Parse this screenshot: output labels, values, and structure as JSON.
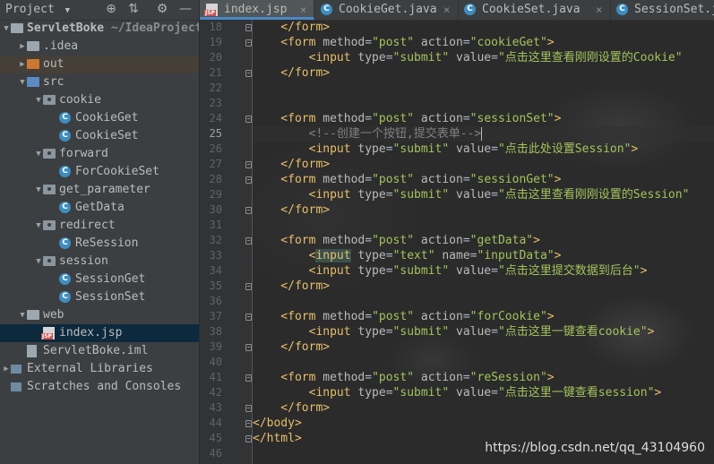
{
  "project_panel": {
    "title": "Project",
    "toolbar_icons": [
      "target-icon",
      "collapse-icon",
      "gear-icon",
      "minimize-icon"
    ],
    "tree": [
      {
        "label": "ServletBoke",
        "suffix": "~/IdeaProjects",
        "indent": 0,
        "arrow": "down",
        "icon": "module",
        "bold": true
      },
      {
        "label": ".idea",
        "indent": 1,
        "arrow": "right",
        "icon": "folder-grey"
      },
      {
        "label": "out",
        "indent": 1,
        "arrow": "right",
        "icon": "folder-orange",
        "highlight": true
      },
      {
        "label": "src",
        "indent": 1,
        "arrow": "down",
        "icon": "folder-blue"
      },
      {
        "label": "cookie",
        "indent": 2,
        "arrow": "down",
        "icon": "package"
      },
      {
        "label": "CookieGet",
        "indent": 3,
        "arrow": "",
        "icon": "class"
      },
      {
        "label": "CookieSet",
        "indent": 3,
        "arrow": "",
        "icon": "class"
      },
      {
        "label": "forward",
        "indent": 2,
        "arrow": "down",
        "icon": "package"
      },
      {
        "label": "ForCookieSet",
        "indent": 3,
        "arrow": "",
        "icon": "class"
      },
      {
        "label": "get_parameter",
        "indent": 2,
        "arrow": "down",
        "icon": "package"
      },
      {
        "label": "GetData",
        "indent": 3,
        "arrow": "",
        "icon": "class"
      },
      {
        "label": "redirect",
        "indent": 2,
        "arrow": "down",
        "icon": "package"
      },
      {
        "label": "ReSession",
        "indent": 3,
        "arrow": "",
        "icon": "class"
      },
      {
        "label": "session",
        "indent": 2,
        "arrow": "down",
        "icon": "package"
      },
      {
        "label": "SessionGet",
        "indent": 3,
        "arrow": "",
        "icon": "class"
      },
      {
        "label": "SessionSet",
        "indent": 3,
        "arrow": "",
        "icon": "class"
      },
      {
        "label": "web",
        "indent": 1,
        "arrow": "down",
        "icon": "folder-web"
      },
      {
        "label": "index.jsp",
        "indent": 2,
        "arrow": "",
        "icon": "jsp",
        "selected": true
      },
      {
        "label": "ServletBoke.iml",
        "indent": 1,
        "arrow": "",
        "icon": "iml"
      },
      {
        "label": "External Libraries",
        "indent": 0,
        "arrow": "right",
        "icon": "library"
      },
      {
        "label": "Scratches and Consoles",
        "indent": 0,
        "arrow": "",
        "icon": "scratch"
      }
    ]
  },
  "tabs": [
    {
      "label": "index.jsp",
      "icon": "jsp",
      "active": true
    },
    {
      "label": "CookieGet.java",
      "icon": "class",
      "active": false
    },
    {
      "label": "CookieSet.java",
      "icon": "class",
      "active": false
    },
    {
      "label": "SessionSet.ja",
      "icon": "class",
      "active": false
    }
  ],
  "editor": {
    "current_line": 25,
    "lines": [
      {
        "n": "18",
        "tokens": [
          [
            "tag",
            "    </form>"
          ]
        ]
      },
      {
        "n": "19",
        "tokens": [
          [
            "tag",
            "    <form "
          ],
          [
            "attr",
            "method"
          ],
          [
            "eq",
            "="
          ],
          [
            "val",
            "\"post\""
          ],
          [
            "tag",
            " "
          ],
          [
            "attr",
            "action"
          ],
          [
            "eq",
            "="
          ],
          [
            "val",
            "\"cookieGet\""
          ],
          [
            "tag",
            ">"
          ]
        ]
      },
      {
        "n": "20",
        "tokens": [
          [
            "tag",
            "        <input "
          ],
          [
            "attr",
            "type"
          ],
          [
            "eq",
            "="
          ],
          [
            "val",
            "\"submit\""
          ],
          [
            "tag",
            " "
          ],
          [
            "attr",
            "value"
          ],
          [
            "eq",
            "="
          ],
          [
            "val",
            "\"点击这里查看刚刚设置的Cookie\""
          ]
        ]
      },
      {
        "n": "21",
        "tokens": [
          [
            "tag",
            "    </form>"
          ]
        ]
      },
      {
        "n": "22",
        "tokens": []
      },
      {
        "n": "23",
        "tokens": []
      },
      {
        "n": "24",
        "tokens": [
          [
            "tag",
            "    <form "
          ],
          [
            "attr",
            "method"
          ],
          [
            "eq",
            "="
          ],
          [
            "val",
            "\"post\""
          ],
          [
            "tag",
            " "
          ],
          [
            "attr",
            "action"
          ],
          [
            "eq",
            "="
          ],
          [
            "val",
            "\"sessionSet\""
          ],
          [
            "tag",
            ">"
          ]
        ]
      },
      {
        "n": "25",
        "tokens": [
          [
            "comment",
            "        <!--创建一个按钮,提交表单-->"
          ]
        ]
      },
      {
        "n": "26",
        "tokens": [
          [
            "tag",
            "        <input "
          ],
          [
            "attr",
            "type"
          ],
          [
            "eq",
            "="
          ],
          [
            "val",
            "\"submit\""
          ],
          [
            "tag",
            " "
          ],
          [
            "attr",
            "value"
          ],
          [
            "eq",
            "="
          ],
          [
            "val",
            "\"点击此处设置Session\""
          ],
          [
            "tag",
            ">"
          ]
        ]
      },
      {
        "n": "27",
        "tokens": [
          [
            "tag",
            "    </form>"
          ]
        ]
      },
      {
        "n": "28",
        "tokens": [
          [
            "tag",
            "    <form "
          ],
          [
            "attr",
            "method"
          ],
          [
            "eq",
            "="
          ],
          [
            "val",
            "\"post\""
          ],
          [
            "tag",
            " "
          ],
          [
            "attr",
            "action"
          ],
          [
            "eq",
            "="
          ],
          [
            "val",
            "\"sessionGet\""
          ],
          [
            "tag",
            ">"
          ]
        ]
      },
      {
        "n": "29",
        "tokens": [
          [
            "tag",
            "        <input "
          ],
          [
            "attr",
            "type"
          ],
          [
            "eq",
            "="
          ],
          [
            "val",
            "\"submit\""
          ],
          [
            "tag",
            " "
          ],
          [
            "attr",
            "value"
          ],
          [
            "eq",
            "="
          ],
          [
            "val",
            "\"点击这里查看刚刚设置的Session\""
          ]
        ]
      },
      {
        "n": "30",
        "tokens": [
          [
            "tag",
            "    </form>"
          ]
        ]
      },
      {
        "n": "31",
        "tokens": []
      },
      {
        "n": "32",
        "tokens": [
          [
            "tag",
            "    <form "
          ],
          [
            "attr",
            "method"
          ],
          [
            "eq",
            "="
          ],
          [
            "val",
            "\"post\""
          ],
          [
            "tag",
            " "
          ],
          [
            "attr",
            "action"
          ],
          [
            "eq",
            "="
          ],
          [
            "val",
            "\"getData\""
          ],
          [
            "tag",
            ">"
          ]
        ]
      },
      {
        "n": "33",
        "tokens": [
          [
            "tag",
            "        <"
          ],
          [
            "match",
            "input"
          ],
          [
            "tag",
            " "
          ],
          [
            "attr",
            "type"
          ],
          [
            "eq",
            "="
          ],
          [
            "val",
            "\"text\""
          ],
          [
            "tag",
            " "
          ],
          [
            "attr",
            "name"
          ],
          [
            "eq",
            "="
          ],
          [
            "val",
            "\"inputData\""
          ],
          [
            "tag",
            ">"
          ]
        ]
      },
      {
        "n": "34",
        "tokens": [
          [
            "tag",
            "        <input "
          ],
          [
            "attr",
            "type"
          ],
          [
            "eq",
            "="
          ],
          [
            "val",
            "\"submit\""
          ],
          [
            "tag",
            " "
          ],
          [
            "attr",
            "value"
          ],
          [
            "eq",
            "="
          ],
          [
            "val",
            "\"点击这里提交数据到后台\""
          ],
          [
            "tag",
            ">"
          ]
        ]
      },
      {
        "n": "35",
        "tokens": [
          [
            "tag",
            "    </form>"
          ]
        ]
      },
      {
        "n": "36",
        "tokens": []
      },
      {
        "n": "37",
        "tokens": [
          [
            "tag",
            "    <form "
          ],
          [
            "attr",
            "method"
          ],
          [
            "eq",
            "="
          ],
          [
            "val",
            "\"post\""
          ],
          [
            "tag",
            " "
          ],
          [
            "attr",
            "action"
          ],
          [
            "eq",
            "="
          ],
          [
            "val",
            "\"forCookie\""
          ],
          [
            "tag",
            ">"
          ]
        ]
      },
      {
        "n": "38",
        "tokens": [
          [
            "tag",
            "        <input "
          ],
          [
            "attr",
            "type"
          ],
          [
            "eq",
            "="
          ],
          [
            "val",
            "\"submit\""
          ],
          [
            "tag",
            " "
          ],
          [
            "attr",
            "value"
          ],
          [
            "eq",
            "="
          ],
          [
            "val",
            "\"点击这里一键查看cookie\""
          ],
          [
            "tag",
            ">"
          ]
        ]
      },
      {
        "n": "39",
        "tokens": [
          [
            "tag",
            "    </form>"
          ]
        ]
      },
      {
        "n": "40",
        "tokens": []
      },
      {
        "n": "41",
        "tokens": [
          [
            "tag",
            "    <form "
          ],
          [
            "attr",
            "method"
          ],
          [
            "eq",
            "="
          ],
          [
            "val",
            "\"post\""
          ],
          [
            "tag",
            " "
          ],
          [
            "attr",
            "action"
          ],
          [
            "eq",
            "="
          ],
          [
            "val",
            "\"reSession\""
          ],
          [
            "tag",
            ">"
          ]
        ]
      },
      {
        "n": "42",
        "tokens": [
          [
            "tag",
            "        <input "
          ],
          [
            "attr",
            "type"
          ],
          [
            "eq",
            "="
          ],
          [
            "val",
            "\"submit\""
          ],
          [
            "tag",
            " "
          ],
          [
            "attr",
            "value"
          ],
          [
            "eq",
            "="
          ],
          [
            "val",
            "\"点击这里一键查看session\""
          ],
          [
            "tag",
            ">"
          ]
        ]
      },
      {
        "n": "43",
        "tokens": [
          [
            "tag",
            "    </form>"
          ]
        ]
      },
      {
        "n": "44",
        "tokens": [
          [
            "tag",
            "</body>"
          ]
        ]
      },
      {
        "n": "45",
        "tokens": [
          [
            "tag",
            "</html>"
          ]
        ]
      },
      {
        "n": "46",
        "tokens": []
      }
    ]
  },
  "watermark": "https://blog.csdn.net/qq_43104960",
  "colors": {
    "tag": "#e8bf6a",
    "attribute": "#bababa",
    "value": "#a5c25c",
    "comment": "#808080",
    "selection": "#0d293e",
    "active_tab_underline": "#4a88c7"
  }
}
